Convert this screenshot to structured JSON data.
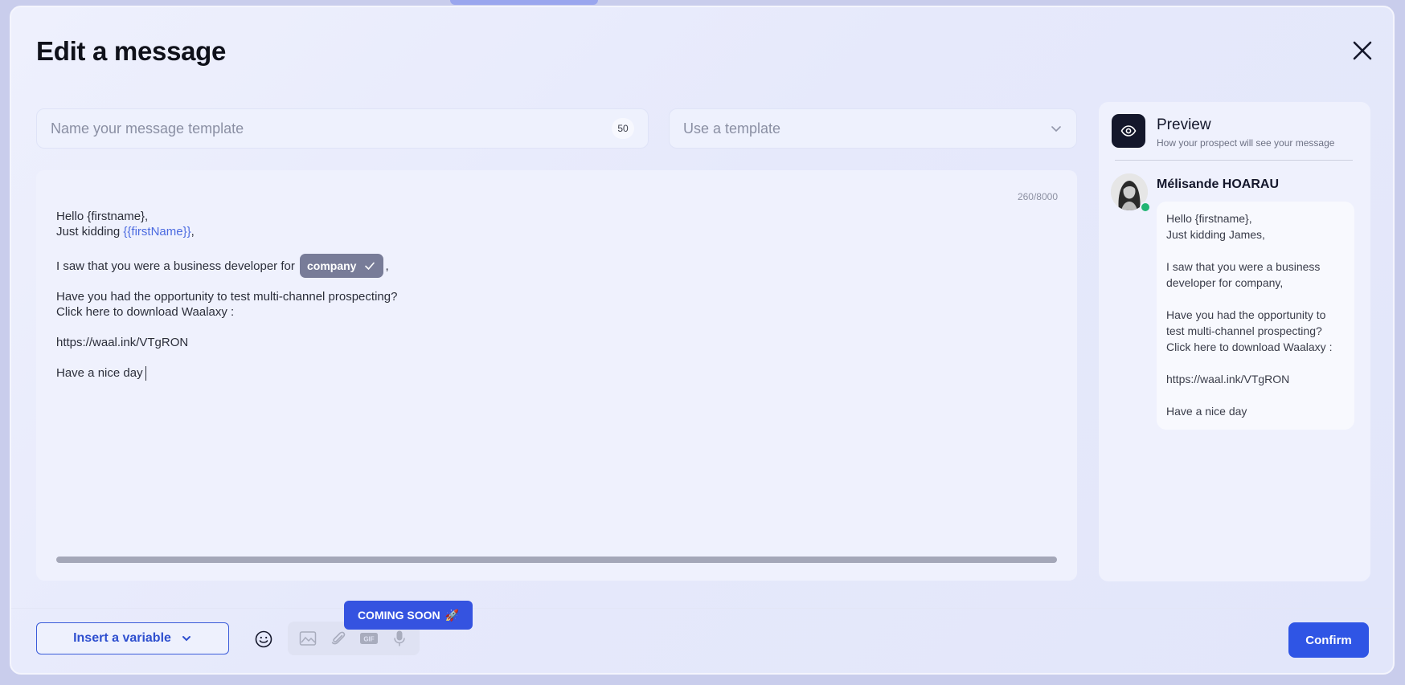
{
  "header": {
    "title": "Edit a message"
  },
  "template_name": {
    "placeholder": "Name your message template",
    "counter": "50"
  },
  "template_select": {
    "placeholder": "Use a template"
  },
  "editor": {
    "char_count": "260/8000",
    "line1": "Hello {firstname},",
    "line2_prefix": "Just kidding ",
    "line2_var": "{{firstName}}",
    "line2_suffix": ",",
    "line3_prefix": "I saw that you were a business developer for ",
    "chip_label": "company",
    "line3_suffix": ",",
    "line4": "Have you had the opportunity to test multi-channel prospecting?",
    "line5": "Click here to download Waalaxy :",
    "line6": "https://waal.ink/VTgRON",
    "line7": "Have a nice day"
  },
  "preview": {
    "title": "Preview",
    "subtitle": "How your prospect will see your message",
    "prospect_name": "Mélisande HOARAU",
    "lines": [
      "Hello {firstname},",
      "Just kidding James,",
      "",
      "I saw that you were a business",
      "developer for company,",
      "",
      "Have you had the opportunity to",
      "test multi-channel prospecting?",
      "Click here to download Waalaxy :",
      "",
      "https://waal.ink/VTgRON",
      "",
      "Have a nice day"
    ]
  },
  "footer": {
    "insert_variable": "Insert a variable",
    "coming_soon": "COMING SOON",
    "coming_soon_emoji": "🚀",
    "gif_label": "GIF",
    "confirm": "Confirm"
  },
  "icons": {
    "close": "close-icon",
    "chevron": "chevron-down-icon",
    "eye": "eye-icon",
    "check": "check-icon",
    "emoji": "emoji-icon",
    "image": "image-icon",
    "attachment": "paperclip-icon",
    "gif": "gif-icon",
    "mic": "microphone-icon"
  },
  "colors": {
    "accent": "#2f55e5",
    "chip": "#787c98",
    "online": "#22b573",
    "variable": "#4b6ae0"
  }
}
